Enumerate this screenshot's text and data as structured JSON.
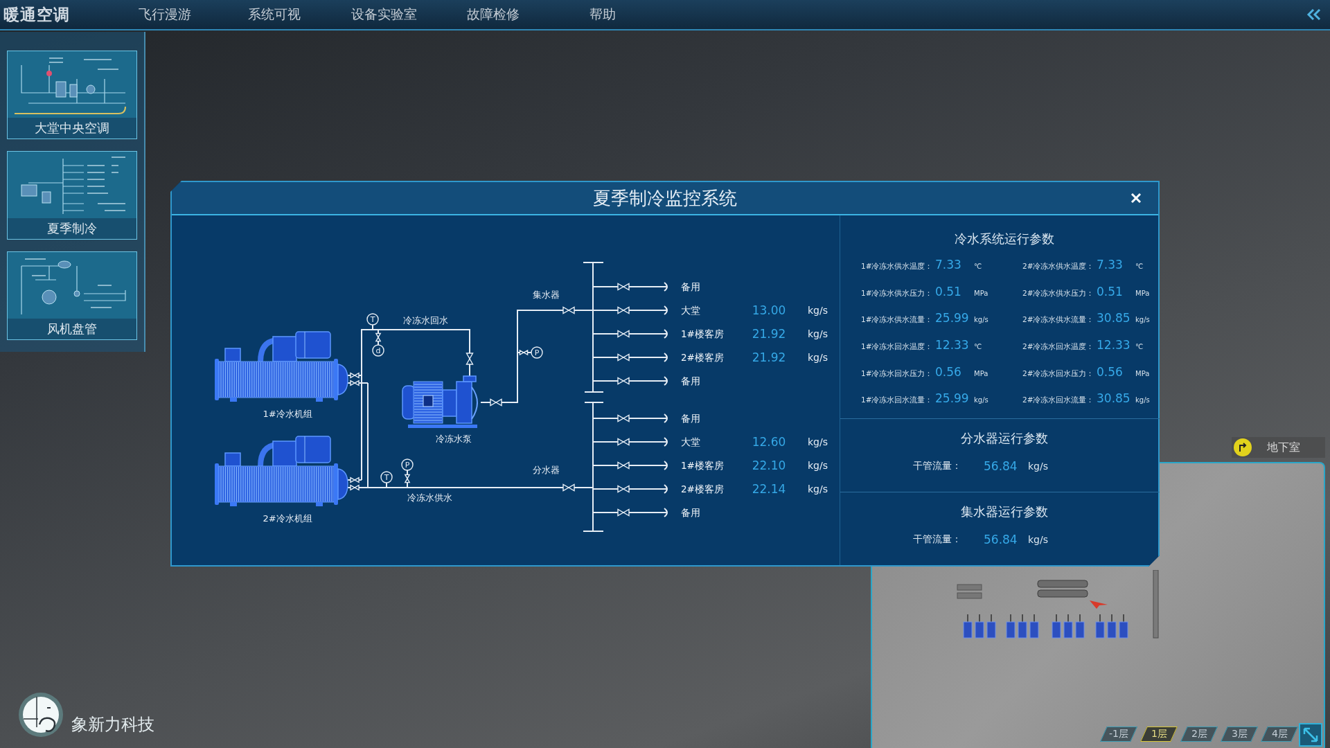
{
  "top_bar": {
    "title": "暖通空调",
    "menu": [
      "飞行漫游",
      "系统可视",
      "设备实验室",
      "故障检修",
      "帮助"
    ]
  },
  "sidebar": {
    "items": [
      "大堂中央空调",
      "夏季制冷",
      "风机盘管"
    ]
  },
  "dialog": {
    "title": "夏季制冷监控系统",
    "diagram": {
      "chillers": [
        "1#冷水机组",
        "2#冷水机组"
      ],
      "pump": {
        "label": "冷冻水泵",
        "outlet_gauge": "P"
      },
      "return_line": {
        "label": "冷冻水回水",
        "gauges": [
          "T",
          "d"
        ]
      },
      "supply_line": {
        "label": "冷冻水供水",
        "gauges": [
          "T",
          "P"
        ]
      },
      "collector": {
        "label": "集水器",
        "branches": [
          {
            "name": "备用"
          },
          {
            "name": "大堂",
            "flow": "13.00",
            "unit": "kg/s"
          },
          {
            "name": "1#楼客房",
            "flow": "21.92",
            "unit": "kg/s"
          },
          {
            "name": "2#楼客房",
            "flow": "21.92",
            "unit": "kg/s"
          },
          {
            "name": "备用"
          }
        ]
      },
      "distributor": {
        "label": "分水器",
        "branches": [
          {
            "name": "备用"
          },
          {
            "name": "大堂",
            "flow": "12.60",
            "unit": "kg/s"
          },
          {
            "name": "1#楼客房",
            "flow": "22.10",
            "unit": "kg/s"
          },
          {
            "name": "2#楼客房",
            "flow": "22.14",
            "unit": "kg/s"
          },
          {
            "name": "备用"
          }
        ]
      }
    },
    "parameters": [
      {
        "kind": "grid",
        "title": "冷水系统运行参数",
        "items": [
          {
            "label": "1#冷冻水供水温度：",
            "value": "7.33",
            "unit": "℃"
          },
          {
            "label": "2#冷冻水供水温度：",
            "value": "7.33",
            "unit": "℃"
          },
          {
            "label": "1#冷冻水供水压力：",
            "value": "0.51",
            "unit": "MPa"
          },
          {
            "label": "2#冷冻水供水压力：",
            "value": "0.51",
            "unit": "MPa"
          },
          {
            "label": "1#冷冻水供水流量：",
            "value": "25.99",
            "unit": "kg/s"
          },
          {
            "label": "2#冷冻水供水流量：",
            "value": "30.85",
            "unit": "kg/s"
          },
          {
            "label": "1#冷冻水回水温度：",
            "value": "12.33",
            "unit": "℃"
          },
          {
            "label": "2#冷冻水回水温度：",
            "value": "12.33",
            "unit": "℃"
          },
          {
            "label": "1#冷冻水回水压力：",
            "value": "0.56",
            "unit": "MPa"
          },
          {
            "label": "2#冷冻水回水压力：",
            "value": "0.56",
            "unit": "MPa"
          },
          {
            "label": "1#冷冻水回水流量：",
            "value": "25.99",
            "unit": "kg/s"
          },
          {
            "label": "2#冷冻水回水流量：",
            "value": "30.85",
            "unit": "kg/s"
          }
        ]
      },
      {
        "kind": "single",
        "title": "分水器运行参数",
        "items": [
          {
            "label": "干管流量：",
            "value": "56.84",
            "unit": "kg/s"
          }
        ]
      },
      {
        "kind": "single",
        "title": "集水器运行参数",
        "items": [
          {
            "label": "干管流量：",
            "value": "56.84",
            "unit": "kg/s"
          }
        ]
      }
    ]
  },
  "floor_map": {
    "location": "地下室",
    "floors": [
      {
        "label": "-1层",
        "selected": false
      },
      {
        "label": "1层",
        "selected": true
      },
      {
        "label": "2层",
        "selected": false
      },
      {
        "label": "3层",
        "selected": false
      },
      {
        "label": "4层",
        "selected": false
      }
    ]
  },
  "brand": {
    "name": "象新力科技"
  }
}
